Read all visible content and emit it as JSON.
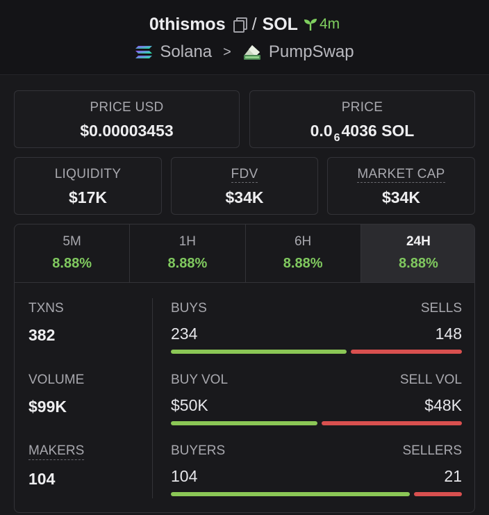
{
  "header": {
    "token": "0thismos",
    "slash": "/",
    "pair_quote": "SOL",
    "age": "4m",
    "chain": "Solana",
    "chevron": ">",
    "dex": "PumpSwap",
    "icons": [
      "copy-icon",
      "sprout-icon",
      "solana-icon",
      "chevron-right-icon",
      "pumpswap-icon"
    ]
  },
  "prices": {
    "usd_label": "PRICE USD",
    "usd_value": "$0.00003453",
    "native_label": "PRICE",
    "native_prefix": "0.0",
    "native_zeros": "6",
    "native_suffix": "4036 SOL"
  },
  "metrics": {
    "liquidity_label": "LIQUIDITY",
    "liquidity_value": "$17K",
    "fdv_label": "FDV",
    "fdv_value": "$34K",
    "mcap_label": "MARKET CAP",
    "mcap_value": "$34K"
  },
  "tabs": [
    {
      "label": "5M",
      "value": "8.88%"
    },
    {
      "label": "1H",
      "value": "8.88%"
    },
    {
      "label": "6H",
      "value": "8.88%"
    },
    {
      "label": "24H",
      "value": "8.88%",
      "active": true
    }
  ],
  "stats": {
    "txns_label": "TXNS",
    "txns_value": "382",
    "volume_label": "VOLUME",
    "volume_value": "$99K",
    "makers_label": "MAKERS",
    "makers_value": "104",
    "buys_label": "BUYS",
    "buys_value": "234",
    "sells_label": "SELLS",
    "sells_value": "148",
    "buys_fraction": 0.613,
    "buy_vol_label": "BUY VOL",
    "buy_vol_value": "$50K",
    "sell_vol_label": "SELL VOL",
    "sell_vol_value": "$48K",
    "buy_vol_fraction": 0.51,
    "buyers_label": "BUYERS",
    "buyers_value": "104",
    "sellers_label": "SELLERS",
    "sellers_value": "21",
    "buyers_fraction": 0.832
  },
  "colors": {
    "positive": "#80c95f",
    "buy_bar": "#8bc756",
    "sell_bar": "#d9504f"
  }
}
